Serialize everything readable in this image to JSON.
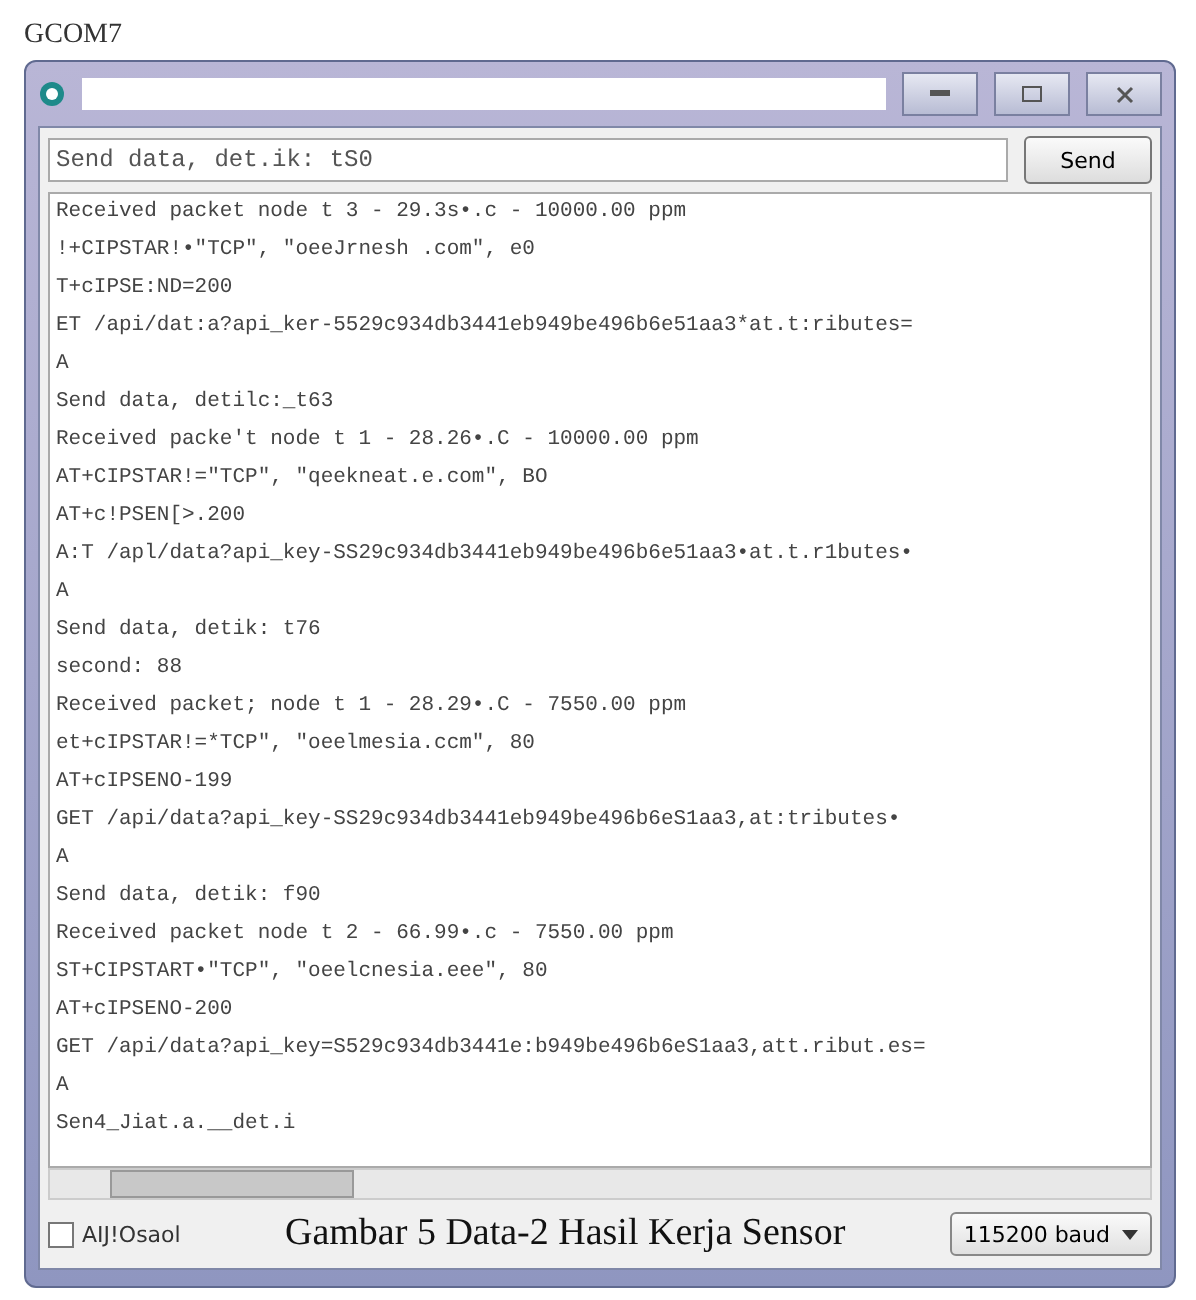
{
  "page_heading": "GCOM7",
  "window": {
    "input": {
      "value": "Send data, det.ik: tS0"
    },
    "send_button": "Send",
    "log": [
      "Received packet node t 3 - 29.3s•.c - 10000.00 ppm",
      "!+CIPSTAR!•\"TCP\", \"oeeJrnesh .com\", e0",
      "T+cIPSE:ND=200",
      "ET /api/dat:a?api_ker-5529c934db3441eb949be496b6e51aa3*at.t:ributes=",
      "A",
      "Send data, detilc:_t63",
      "Received packe't node t 1 - 28.26•.C - 10000.00 ppm",
      "AT+CIPSTAR!=\"TCP\", \"qeekneat.e.com\", BO",
      "AT+c!PSEN[>.200",
      "A:T /apl/data?api_key-SS29c934db3441eb949be496b6e51aa3•at.t.r1butes•",
      "A",
      "Send data, detik: t76",
      "second: 88",
      "Received packet; node t 1 - 28.29•.C - 7550.00 ppm",
      "et+cIPSTAR!=*TCP\", \"oeelmesia.ccm\", 80",
      "AT+cIPSENO-199",
      "GET /api/data?api_key-SS29c934db3441eb949be496b6eS1aa3,at:tributes•",
      "A",
      "Send data, detik: f90",
      "Received packet node t 2 - 66.99•.c - 7550.00 ppm",
      "ST+CIPSTART•\"TCP\", \"oeelcnesia.eee\", 80",
      "AT+cIPSENO-200",
      "GET /api/data?api_key=S529c934db3441e:b949be496b6eS1aa3,att.ribut.es=",
      "A",
      "Sen4_Jiat.a.__det.i"
    ],
    "autoscroll": {
      "label": "AIJ!Osaol",
      "checked": false
    },
    "baud": "115200 baud"
  },
  "caption": "Gambar 5 Data-2 Hasil Kerja Sensor"
}
